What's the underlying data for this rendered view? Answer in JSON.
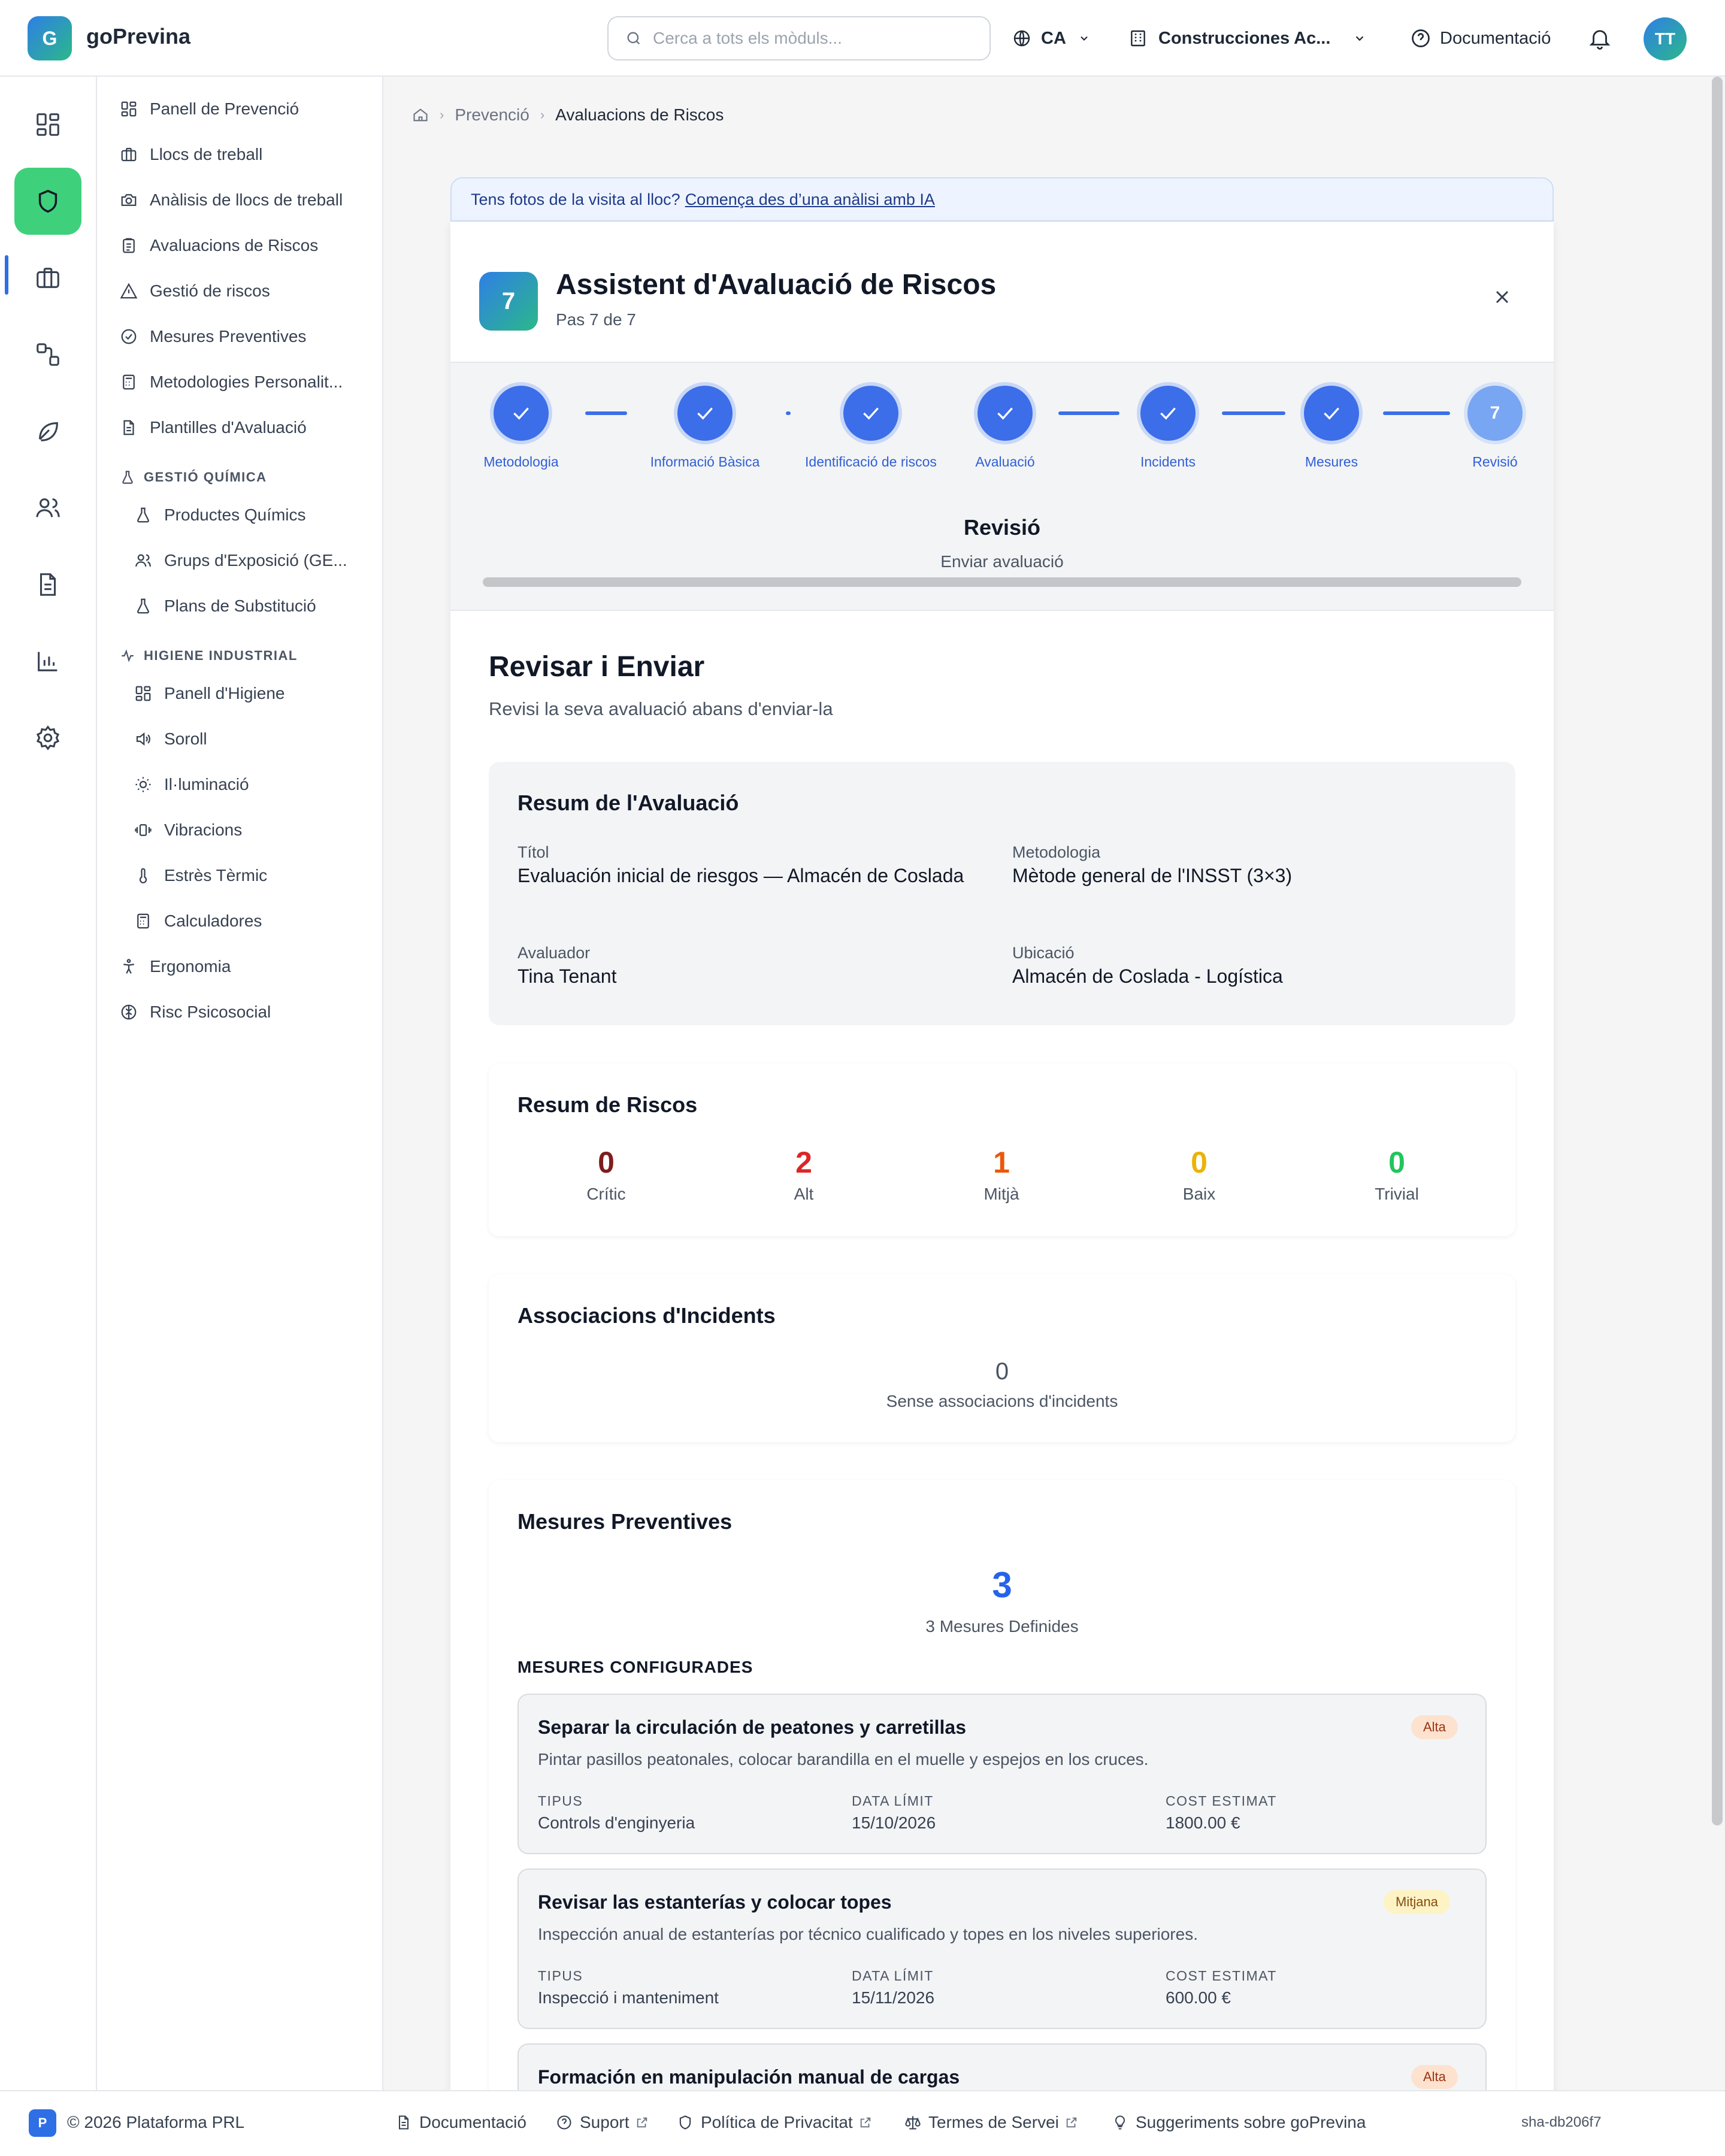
{
  "header": {
    "logo_letter": "G",
    "brand": "goPrevina",
    "search_placeholder": "Cerca a tots els mòduls...",
    "language": "CA",
    "company": "Construcciones Ac...",
    "docs": "Documentació",
    "avatar": "TT"
  },
  "rail": [
    "dashboard-icon",
    "shield-icon",
    "briefcase-icon",
    "flow-icon",
    "leaf-icon",
    "users-icon",
    "document-icon",
    "chart-icon",
    "gear-icon"
  ],
  "sidebar": {
    "items": [
      {
        "label": "Panell de Prevenció",
        "icon": "dashboard-icon"
      },
      {
        "label": "Llocs de treball",
        "icon": "briefcase-icon"
      },
      {
        "label": "Anàlisis de llocs de treball",
        "icon": "camera-icon"
      },
      {
        "label": "Avaluacions de Riscos",
        "icon": "clipboard-icon"
      },
      {
        "label": "Gestió de riscos",
        "icon": "warning-icon"
      },
      {
        "label": "Mesures Preventives",
        "icon": "check-circle-icon"
      },
      {
        "label": "Metodologies Personalit...",
        "icon": "calculator-icon"
      },
      {
        "label": "Plantilles d'Avaluació",
        "icon": "file-icon"
      }
    ],
    "section_chem": "GESTIÓ QUÍMICA",
    "chem_items": [
      {
        "label": "Productes Químics",
        "icon": "flask-icon"
      },
      {
        "label": "Grups d'Exposició (GE...",
        "icon": "users-icon"
      },
      {
        "label": "Plans de Substitució",
        "icon": "flask-icon"
      }
    ],
    "section_hyg": "HIGIENE INDUSTRIAL",
    "hyg_items": [
      {
        "label": "Panell d'Higiene",
        "icon": "dashboard-icon"
      },
      {
        "label": "Soroll",
        "icon": "speaker-icon"
      },
      {
        "label": "Il·luminació",
        "icon": "sun-icon"
      },
      {
        "label": "Vibracions",
        "icon": "vibration-icon"
      },
      {
        "label": "Estrès Tèrmic",
        "icon": "thermometer-icon"
      },
      {
        "label": "Calculadores",
        "icon": "calculator-icon"
      }
    ],
    "tail_items": [
      {
        "label": "Ergonomia",
        "icon": "person-icon"
      },
      {
        "label": "Risc Psicosocial",
        "icon": "brain-icon"
      }
    ]
  },
  "breadcrumb": {
    "parent": "Prevenció",
    "current": "Avaluacions de Riscos"
  },
  "banner": {
    "text": "Tens fotos de la visita al lloc?",
    "link": "Comença des d’una anàlisi amb IA"
  },
  "wizard": {
    "step_number": "7",
    "title": "Assistent d'Avaluació de Riscos",
    "subtitle": "Pas 7 de 7",
    "steps": [
      {
        "label": "Metodologia"
      },
      {
        "label": "Informació Bàsica"
      },
      {
        "label": "Identificació de riscos"
      },
      {
        "label": "Avaluació"
      },
      {
        "label": "Incidents"
      },
      {
        "label": "Mesures"
      },
      {
        "label": "Revisió",
        "number": "7"
      }
    ],
    "current_step_title": "Revisió",
    "current_step_desc": "Enviar avaluació"
  },
  "review": {
    "title": "Revisar i Enviar",
    "subtitle": "Revisi la seva avaluació abans d'enviar-la",
    "summary": {
      "title": "Resum de l'Avaluació",
      "fields": [
        {
          "label": "Títol",
          "value": "Evaluación inicial de riesgos — Almacén de Coslada"
        },
        {
          "label": "Metodologia",
          "value": "Mètode general de l'INSST (3×3)"
        },
        {
          "label": "Avaluador",
          "value": "Tina Tenant"
        },
        {
          "label": "Ubicació",
          "value": "Almacén de Coslada - Logística"
        }
      ]
    },
    "risks": {
      "title": "Resum de Riscos",
      "items": [
        {
          "count": "0",
          "label": "Crític",
          "color": "#7f1d1d"
        },
        {
          "count": "2",
          "label": "Alt",
          "color": "#dc2626"
        },
        {
          "count": "1",
          "label": "Mitjà",
          "color": "#ea580c"
        },
        {
          "count": "0",
          "label": "Baix",
          "color": "#eab308"
        },
        {
          "count": "0",
          "label": "Trivial",
          "color": "#22c55e"
        }
      ]
    },
    "incidents": {
      "title": "Associacions d'Incidents",
      "count": "0",
      "text": "Sense associacions d'incidents"
    },
    "measures": {
      "title": "Mesures Preventives",
      "count": "3",
      "count_text": "3 Mesures Definides",
      "section": "MESURES CONFIGURADES",
      "col_type": "TIPUS",
      "col_date": "DATA LÍMIT",
      "col_cost": "COST ESTIMAT",
      "items": [
        {
          "title": "Separar la circulación de peatones y carretillas",
          "priority": "Alta",
          "desc": "Pintar pasillos peatonales, colocar barandilla en el muelle y espejos en los cruces.",
          "type": "Controls d'enginyeria",
          "date": "15/10/2026",
          "cost": "1800.00 €"
        },
        {
          "title": "Revisar las estanterías y colocar topes",
          "priority": "Mitjana",
          "desc": "Inspección anual de estanterías por técnico cualificado y topes en los niveles superiores.",
          "type": "Inspecció i manteniment",
          "date": "15/11/2026",
          "cost": "600.00 €"
        },
        {
          "title": "Formación en manipulación manual de cargas",
          "priority": "Alta",
          "desc": "",
          "type": "",
          "date": "",
          "cost": ""
        }
      ]
    }
  },
  "footer": {
    "logo_letter": "P",
    "copyright": "© 2026 Plataforma PRL",
    "docs": "Documentació",
    "support": "Suport",
    "privacy": "Política de Privacitat",
    "terms": "Termes de Servei",
    "suggestions": "Suggeriments sobre goPrevina",
    "version": "sha-db206f7"
  },
  "colors": {
    "accent": "#3b6ee8",
    "active_module": "#3fd07c",
    "priority_alta": "#fde2cf",
    "priority_mitjana": "#fdf3c4"
  }
}
